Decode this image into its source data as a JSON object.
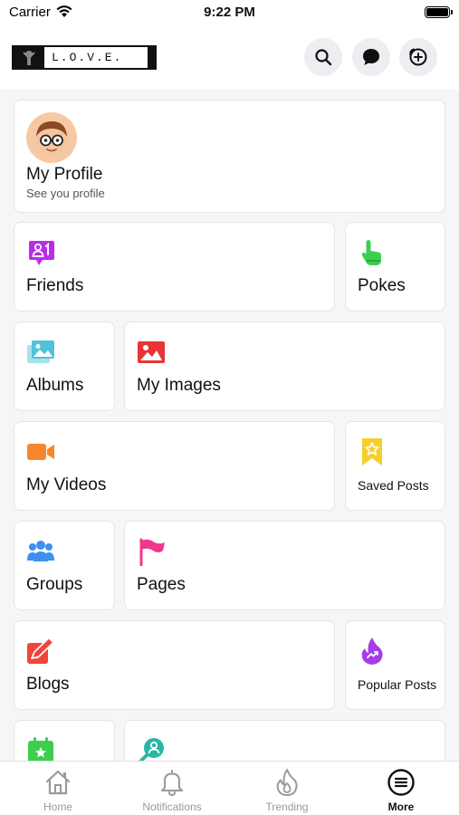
{
  "status_bar": {
    "carrier": "Carrier",
    "time": "9:22 PM"
  },
  "header": {
    "logo_text": "L.O.V.E."
  },
  "menu": {
    "profile": {
      "title": "My Profile",
      "subtitle": "See you profile"
    },
    "friends": "Friends",
    "pokes": "Pokes",
    "albums": "Albums",
    "my_images": "My Images",
    "my_videos": "My Videos",
    "saved_posts": "Saved Posts",
    "groups": "Groups",
    "pages": "Pages",
    "blogs": "Blogs",
    "popular_posts": "Popular Posts"
  },
  "tabs": [
    {
      "label": "Home",
      "icon": "home-icon"
    },
    {
      "label": "Notifications",
      "icon": "bell-icon"
    },
    {
      "label": "Trending",
      "icon": "flame-icon"
    },
    {
      "label": "More",
      "icon": "menu-icon"
    }
  ],
  "colors": {
    "friends": "#b72ee8",
    "pokes": "#3ccf4e",
    "albums": "#4fc3d9",
    "my_images": "#e83434",
    "my_videos": "#f7862a",
    "saved_posts": "#f5cf2a",
    "groups": "#3f8ff0",
    "pages": "#f0368e",
    "blogs": "#f0453a",
    "popular_posts": "#a63de8",
    "events": "#3ccf4e",
    "find_friends": "#2bb5a6"
  }
}
